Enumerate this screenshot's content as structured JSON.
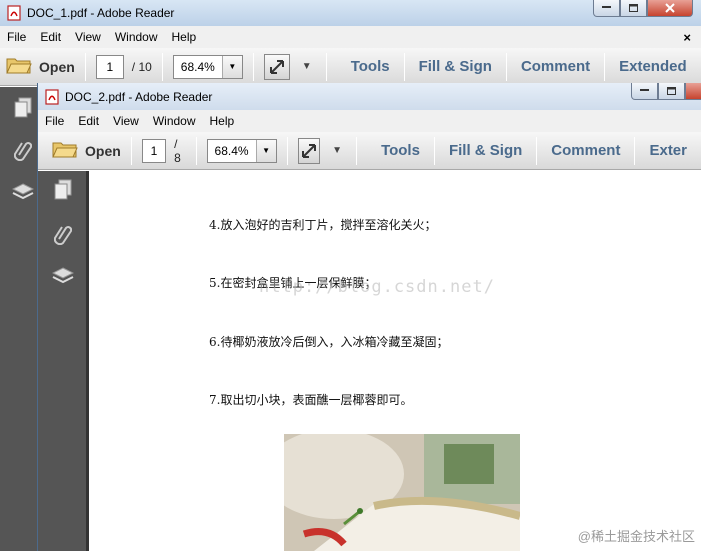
{
  "window1": {
    "title": "DOC_1.pdf - Adobe Reader",
    "menu": [
      "File",
      "Edit",
      "View",
      "Window",
      "Help"
    ],
    "close_label": "×",
    "toolbar": {
      "open_label": "Open",
      "page_current": "1",
      "page_total": "/ 10",
      "zoom": "68.4%",
      "tools_label": "Tools",
      "fill_sign_label": "Fill & Sign",
      "comment_label": "Comment",
      "extended_label": "Extended"
    }
  },
  "window2": {
    "title": "DOC_2.pdf - Adobe Reader",
    "menu": [
      "File",
      "Edit",
      "View",
      "Window",
      "Help"
    ],
    "toolbar": {
      "open_label": "Open",
      "page_current": "1",
      "page_total": "/ 8",
      "zoom": "68.4%",
      "tools_label": "Tools",
      "fill_sign_label": "Fill & Sign",
      "comment_label": "Comment",
      "extended_label": "Exter"
    },
    "document": {
      "lines": [
        "4.放入泡好的吉利丁片，搅拌至溶化关火；",
        "5.在密封盒里铺上一层保鲜膜；",
        "6.待椰奶液放冷后倒入，入冰箱冷藏至凝固；",
        "7.取出切小块，表面醮一层椰蓉即可。"
      ],
      "watermark": "http://blog.csdn.net/"
    }
  },
  "corner_watermark": "@稀土掘金技术社区",
  "icons": {
    "pdf": "pdf-file-icon",
    "open": "folder-open-icon",
    "expand": "expand-arrows-icon",
    "pages": "pages-panel-icon",
    "attach": "paperclip-icon",
    "layers": "layers-icon"
  },
  "colors": {
    "link_blue": "#4a6a8c",
    "sidebar": "#555555",
    "titlebar": "#c8d9ec"
  }
}
